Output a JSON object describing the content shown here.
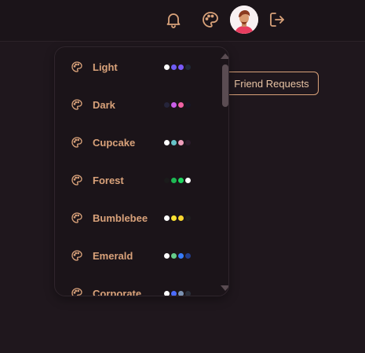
{
  "topbar": {
    "icons": [
      "bell-icon",
      "palette-icon",
      "avatar",
      "logout-icon"
    ]
  },
  "friend_requests_label": "Friend Requests",
  "theme_dropdown": {
    "items": [
      {
        "label": "Light",
        "swatches": [
          "#ffffff",
          "#6f5df5",
          "#7a5af8",
          "#1f2937"
        ]
      },
      {
        "label": "Dark",
        "swatches": [
          "#25243a",
          "#c95fe8",
          "#f062a4",
          "#171726"
        ]
      },
      {
        "label": "Cupcake",
        "swatches": [
          "#ffffff",
          "#65c3c8",
          "#ef9fbc",
          "#2a1b2a"
        ]
      },
      {
        "label": "Forest",
        "swatches": [
          "#1b1b1b",
          "#1eb854",
          "#1fd65f",
          "#ffffff"
        ]
      },
      {
        "label": "Bumblebee",
        "swatches": [
          "#ffffff",
          "#f9e232",
          "#f9d72f",
          "#1f1f1f"
        ]
      },
      {
        "label": "Emerald",
        "swatches": [
          "#ffffff",
          "#66cc8a",
          "#377cfb",
          "#223d8a"
        ]
      },
      {
        "label": "Corporate",
        "swatches": [
          "#ffffff",
          "#4b6bfb",
          "#7b92b2",
          "#2a2f3a"
        ]
      }
    ]
  }
}
